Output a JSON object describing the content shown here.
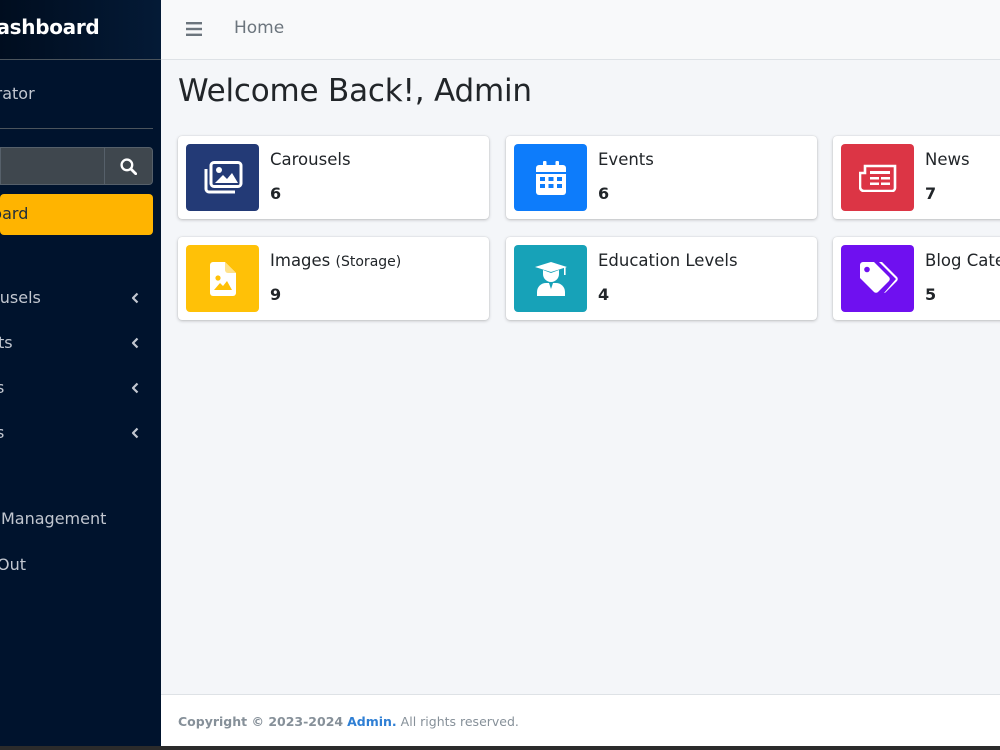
{
  "sidebar": {
    "brand": "ur Dashboard",
    "user": "inistrator",
    "search": {
      "placeholder": ""
    },
    "items": [
      {
        "label": "hboard",
        "active": true
      },
      {
        "label": "ousels",
        "chevron": true
      },
      {
        "label": "ts",
        "chevron": true
      },
      {
        "label": "s",
        "chevron": true
      },
      {
        "label": "s",
        "chevron": true
      },
      {
        "label": "Management"
      },
      {
        "label": "Out"
      }
    ]
  },
  "navbar": {
    "home": "Home"
  },
  "page": {
    "title": "Welcome Back!, Admin"
  },
  "cards": [
    {
      "title": "Carousels",
      "count": "6",
      "color": "#233a76",
      "icon": "images-icon"
    },
    {
      "title": "Events",
      "count": "6",
      "color": "#0d7cfb",
      "icon": "calendar-icon"
    },
    {
      "title": "News",
      "count": "7",
      "color": "#dc3545",
      "icon": "newspaper-icon"
    },
    {
      "title": "Images",
      "subtitle": "(Storage)",
      "count": "9",
      "color": "#ffc107",
      "icon": "image-file-icon"
    },
    {
      "title": "Education Levels",
      "count": "4",
      "color": "#17a2b8",
      "icon": "graduate-icon"
    },
    {
      "title": "Blog Cate",
      "count": "5",
      "color": "#6f10f0",
      "icon": "tags-icon"
    }
  ],
  "footer": {
    "copyright": "Copyright © 2023-2024",
    "brand": "Admin.",
    "rights": "All rights reserved."
  },
  "colors": {
    "sidebar_bg": "#00132d",
    "active_item": "#ffb400",
    "link": "#2f7fd4"
  }
}
